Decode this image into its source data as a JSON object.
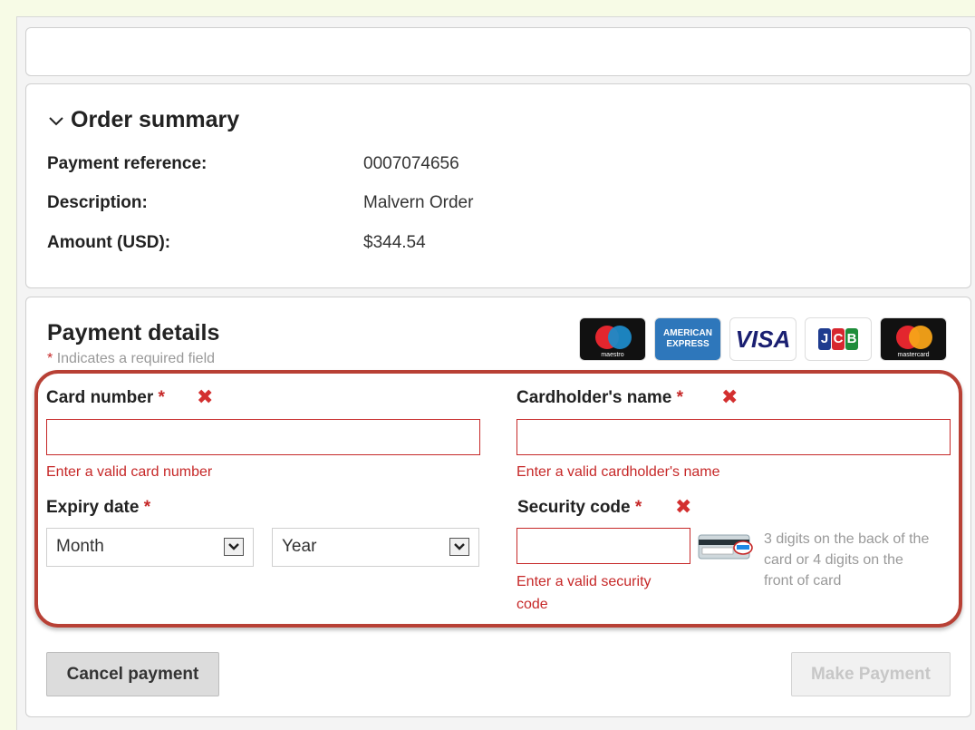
{
  "order_summary": {
    "title": "Order summary",
    "rows": [
      {
        "label": "Payment reference:",
        "value": "0007074656"
      },
      {
        "label": "Description:",
        "value": "Malvern Order"
      },
      {
        "label": "Amount (USD):",
        "value": "$344.54"
      }
    ]
  },
  "payment_details": {
    "title": "Payment details",
    "required_star": "*",
    "required_note": "Indicates a required field",
    "card_logos": {
      "maestro": "maestro",
      "amex_line1": "AMERICAN",
      "amex_line2": "EXPRESS",
      "visa": "VISA",
      "jcb": [
        "J",
        "C",
        "B"
      ],
      "mastercard": "mastercard"
    }
  },
  "fields": {
    "card_number": {
      "label": "Card number",
      "star": "*",
      "error_icon": "✖",
      "value": "",
      "error": "Enter a valid card number"
    },
    "cardholder_name": {
      "label": "Cardholder's name",
      "star": "*",
      "error_icon": "✖",
      "value": "",
      "error": "Enter a valid cardholder's name"
    },
    "expiry_date": {
      "label": "Expiry date",
      "star": "*",
      "month": "Month",
      "year": "Year"
    },
    "security_code": {
      "label": "Security code",
      "star": "*",
      "error_icon": "✖",
      "value": "",
      "error_line1": "Enter a valid security",
      "error_line2": "code",
      "hint_line1": "3 digits on the back of the",
      "hint_line2": "card or 4 digits on the",
      "hint_line3": "front of card"
    }
  },
  "buttons": {
    "cancel": "Cancel payment",
    "make_payment": "Make Payment"
  },
  "colors": {
    "error": "#c62828",
    "highlight_border": "#b84035",
    "page_background": "#f7fbe6"
  }
}
